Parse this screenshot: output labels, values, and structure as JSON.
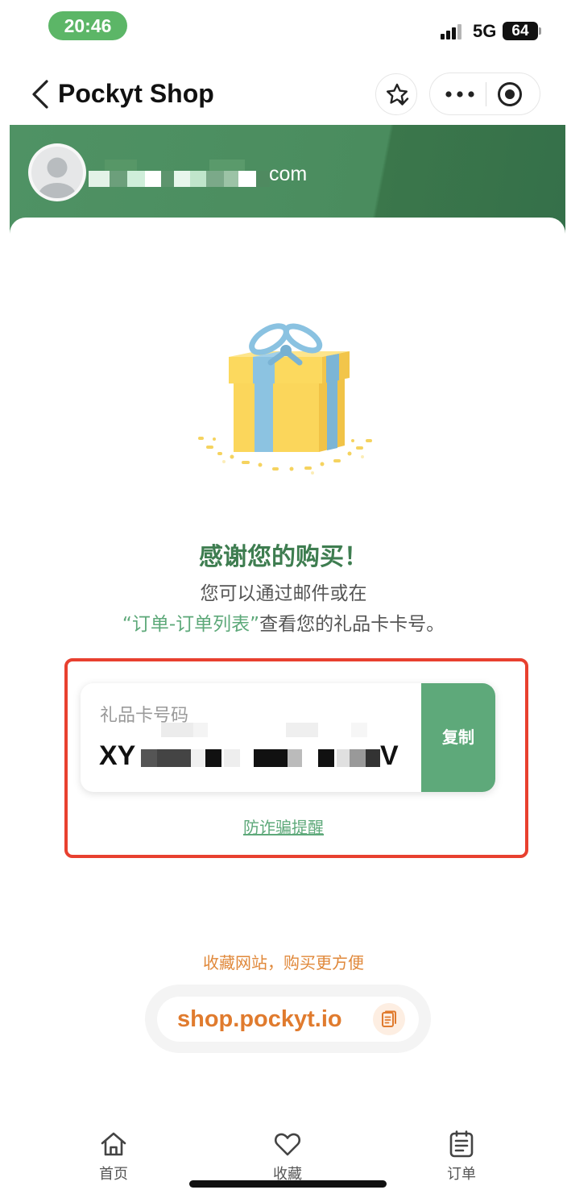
{
  "status_bar": {
    "time": "20:46",
    "network": "5G",
    "battery": "64",
    "icons": [
      "signal-icon",
      "battery-icon"
    ]
  },
  "nav": {
    "title": "Pockyt Shop",
    "icons": [
      "back-chevron-icon",
      "star-check-icon",
      "more-dots-icon",
      "target-icon"
    ]
  },
  "header": {
    "email_visible": "com",
    "avatar_icon": "user-avatar-icon"
  },
  "success": {
    "illustration": "gift-box-icon",
    "title": "感谢您的购买！",
    "line1": "您可以通过邮件或在",
    "line2_highlight": "“订单-订单列表”",
    "line2_rest": "查看您的礼品卡卡号。"
  },
  "gift_card": {
    "label": "礼品卡号码",
    "code_prefix": "XY",
    "code_suffix": "V",
    "copy_label": "复制"
  },
  "fraud_link": {
    "label": "防诈骗提醒"
  },
  "bookmark": {
    "hint": "收藏网站，购买更方便",
    "url": "shop.pockyt.io",
    "copy_icon": "copy-icon"
  },
  "tabbar": {
    "items": [
      {
        "label": "首页",
        "icon": "home-icon"
      },
      {
        "label": "收藏",
        "icon": "heart-icon"
      },
      {
        "label": "订单",
        "icon": "order-list-icon"
      }
    ]
  },
  "colors": {
    "brand_green": "#3e7d50",
    "button_green": "#5ea97a",
    "accent_orange": "#e07b2e",
    "alert_red": "#e8402f",
    "time_pill": "#5cb667"
  }
}
